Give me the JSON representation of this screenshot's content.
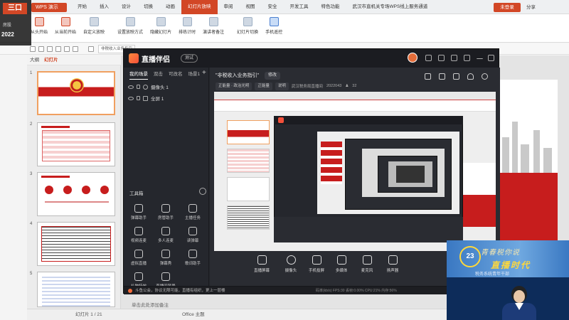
{
  "watermark": {
    "logo": "三口",
    "sub_text": "房股",
    "year": "2022"
  },
  "wps": {
    "app_button": "WPS 演示",
    "menus": [
      "开始",
      "插入",
      "设计",
      "切换",
      "动画",
      "幻灯片放映",
      "审阅",
      "视图",
      "安全",
      "开发工具",
      "特色功能",
      "武汉市直机关专场WPS线上服务通道"
    ],
    "active_menu_index": 5,
    "login_button": "未登录",
    "share_text": "分享",
    "ribbon_tools": [
      "从头开始",
      "从当前开始",
      "自定义放映",
      "设置放映方式",
      "隐藏幻灯片",
      "排练计时",
      "演讲者备注",
      "幻灯片切换",
      "手机遥控"
    ],
    "quick_tab": "非税收入业务指引",
    "outline_tab": "大纲",
    "slides_tab": "幻灯片",
    "slide_thumbnail_title": "非税收入业务指引",
    "slide_numbers": [
      "1",
      "2",
      "3",
      "4",
      "5"
    ],
    "notes_hint": "单击此处添加备注",
    "status_slide": "幻灯片 1 / 21",
    "status_theme": "Office 主题"
  },
  "broadcast": {
    "logo": "直播伴侣",
    "version": "测试",
    "scene_tabs": [
      "我的场景",
      "双击",
      "可改名",
      "场景1"
    ],
    "active_scene_tab_index": 0,
    "add_scene": "+",
    "sources": [
      {
        "label": "摄像头 1",
        "type": "camera"
      },
      {
        "label": "全屏 1",
        "type": "screen"
      }
    ],
    "toolbox_label": "工具箱",
    "tools": [
      [
        "弹幕助手",
        "房管助手",
        "主播任务"
      ],
      [
        "视频连麦",
        "多人连麦",
        "读弹幕"
      ],
      [
        "虚拟直播",
        "弹幕秀",
        "歌词助手"
      ],
      [
        "礼物特效",
        "直播间背景",
        ""
      ]
    ],
    "scene_name": "\"非税收入业务指引\"",
    "scene_edit": "修改",
    "info_chips": [
      "正能量 · 政治光明",
      "正能量",
      "说明"
    ],
    "info_texts": [
      "武汉税务局直播间",
      "2022043"
    ],
    "viewer_count": "32",
    "bottom_buttons": [
      "直播屏幕",
      "摄像头",
      "手机投屏",
      "多媒体",
      "麦克风",
      "扬声器"
    ],
    "notice_text": "斗鱼公会，协议无限可能，直播有组织，更上一层楼",
    "stats_text": "码率(kb/s)   FPS:30   丢帧:0.00%   CPU:21%   内存:56%"
  },
  "webcam": {
    "badge": "23",
    "title_line1": "青春税你说",
    "title_line2": "直播时代",
    "subtitle": "税务系统青年干部"
  },
  "colors": {
    "wps_accent": "#d24726",
    "broadcast_bg": "#23252b",
    "slide_red": "#c71d1d"
  }
}
